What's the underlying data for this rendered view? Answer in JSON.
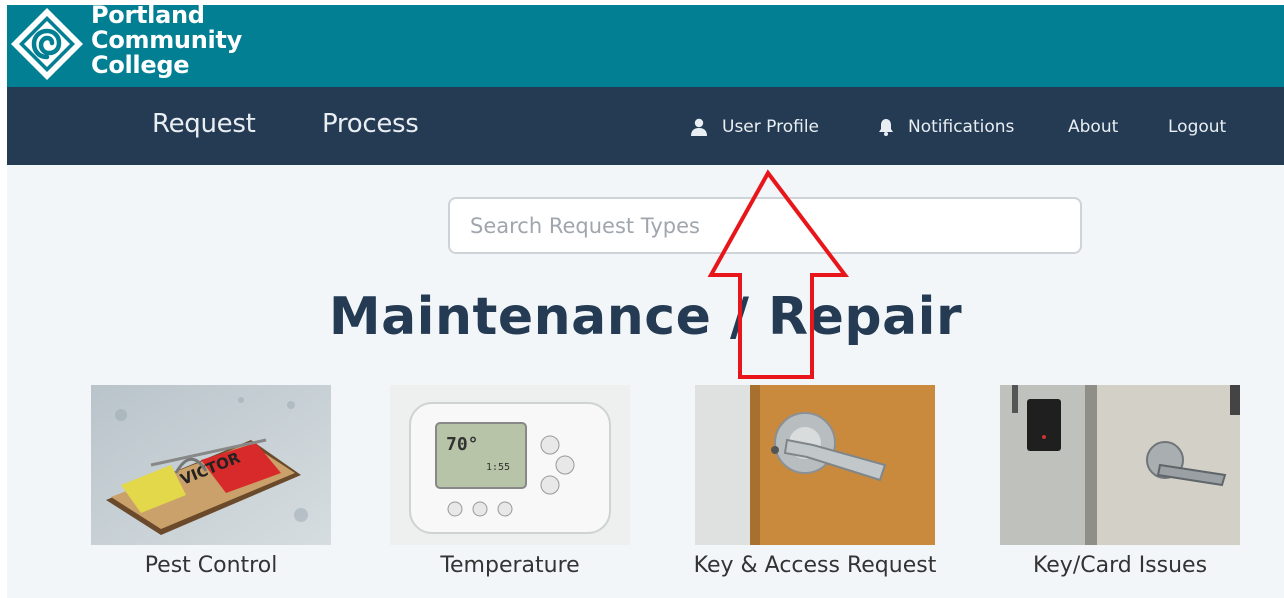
{
  "brand": {
    "lines": [
      "Portland",
      "Community",
      "College"
    ],
    "colors": {
      "brandbar": "#037f93",
      "navbar": "#243b53"
    }
  },
  "nav": {
    "left": [
      {
        "label": "Request"
      },
      {
        "label": "Process"
      }
    ],
    "right": [
      {
        "label": "User Profile",
        "icon": "user-icon"
      },
      {
        "label": "Notifications",
        "icon": "bell-icon"
      },
      {
        "label": "About"
      },
      {
        "label": "Logout"
      }
    ]
  },
  "search": {
    "placeholder": "Search Request Types",
    "value": ""
  },
  "section": {
    "title": "Maintenance / Repair"
  },
  "cards": [
    {
      "label": "Pest Control",
      "image": "mousetrap-image"
    },
    {
      "label": "Temperature",
      "image": "thermostat-image"
    },
    {
      "label": "Key & Access Request",
      "image": "door-lever-image"
    },
    {
      "label": "Key/Card Issues",
      "image": "card-reader-image"
    }
  ],
  "annotation": {
    "type": "arrow",
    "color": "#e8161b",
    "points_to": "User Profile"
  }
}
